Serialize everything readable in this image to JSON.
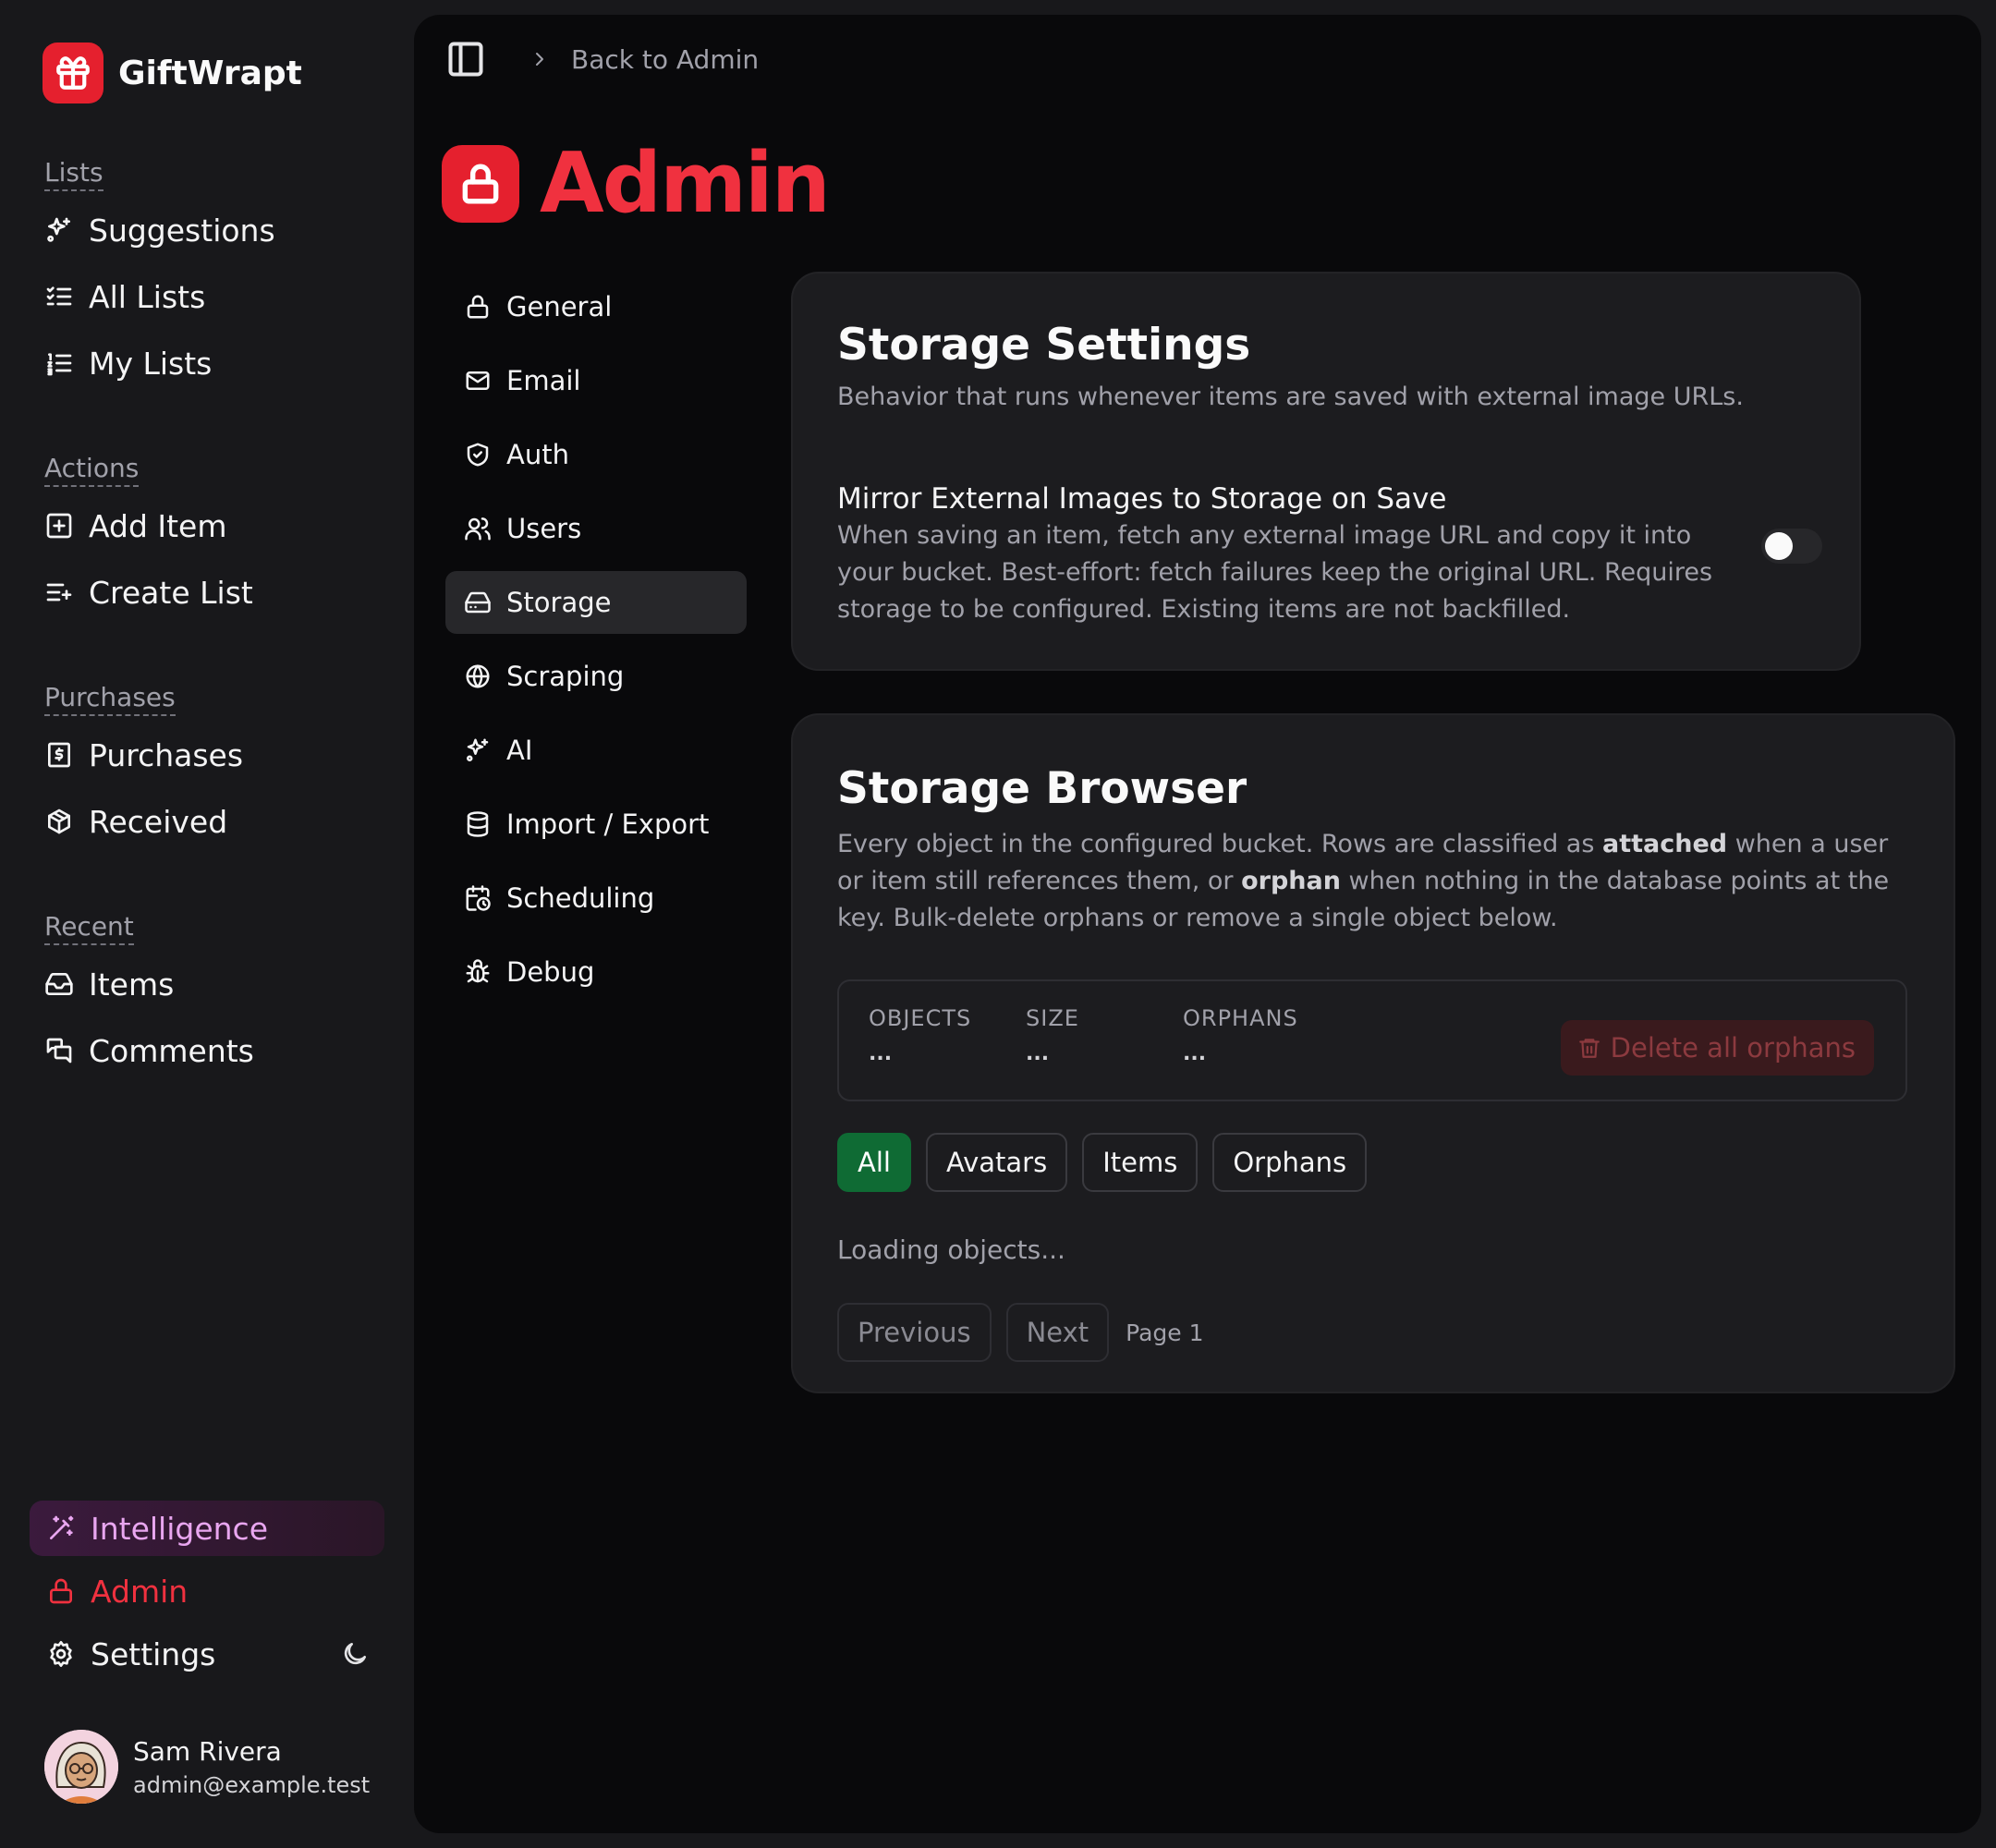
{
  "brand": {
    "name": "GiftWrapt"
  },
  "sidebar": {
    "groups": [
      {
        "label": "Lists",
        "items": [
          {
            "label": "Suggestions",
            "icon": "sparkles-icon"
          },
          {
            "label": "All Lists",
            "icon": "list-checks-icon"
          },
          {
            "label": "My Lists",
            "icon": "list-ordered-icon"
          }
        ]
      },
      {
        "label": "Actions",
        "items": [
          {
            "label": "Add Item",
            "icon": "square-plus-icon"
          },
          {
            "label": "Create List",
            "icon": "list-plus-icon"
          }
        ]
      },
      {
        "label": "Purchases",
        "items": [
          {
            "label": "Purchases",
            "icon": "receipt-icon"
          },
          {
            "label": "Received",
            "icon": "gift-box-icon"
          }
        ]
      },
      {
        "label": "Recent",
        "items": [
          {
            "label": "Items",
            "icon": "inbox-icon"
          },
          {
            "label": "Comments",
            "icon": "messages-icon"
          }
        ]
      }
    ],
    "bottom": {
      "intelligence": "Intelligence",
      "admin": "Admin",
      "settings": "Settings"
    },
    "user": {
      "name": "Sam Rivera",
      "email": "admin@example.test"
    }
  },
  "topbar": {
    "breadcrumb": "Back to Admin"
  },
  "page": {
    "title": "Admin"
  },
  "admin_nav": [
    {
      "label": "General",
      "icon": "lock-icon",
      "active": false
    },
    {
      "label": "Email",
      "icon": "mail-icon",
      "active": false
    },
    {
      "label": "Auth",
      "icon": "shield-check-icon",
      "active": false
    },
    {
      "label": "Users",
      "icon": "users-icon",
      "active": false
    },
    {
      "label": "Storage",
      "icon": "hard-drive-icon",
      "active": true
    },
    {
      "label": "Scraping",
      "icon": "globe-icon",
      "active": false
    },
    {
      "label": "AI",
      "icon": "sparkles-icon",
      "active": false
    },
    {
      "label": "Import / Export",
      "icon": "database-icon",
      "active": false
    },
    {
      "label": "Scheduling",
      "icon": "calendar-clock-icon",
      "active": false
    },
    {
      "label": "Debug",
      "icon": "bug-icon",
      "active": false
    }
  ],
  "storage_settings": {
    "title": "Storage Settings",
    "description": "Behavior that runs whenever items are saved with external image URLs.",
    "mirror_setting": {
      "title": "Mirror External Images to Storage on Save",
      "description": "When saving an item, fetch any external image URL and copy it into your bucket. Best-effort: fetch failures keep the original URL. Requires storage to be configured. Existing items are not backfilled.",
      "enabled": false
    }
  },
  "storage_browser": {
    "title": "Storage Browser",
    "description_parts": {
      "p1": "Every object in the configured bucket. Rows are classified as ",
      "attached": "attached",
      "p2": " when a user or item still references them, or ",
      "orphan": "orphan",
      "p3": " when nothing in the database points at the key. Bulk-delete orphans or remove a single object below."
    },
    "stats": [
      {
        "label": "OBJECTS",
        "value": "..."
      },
      {
        "label": "SIZE",
        "value": "..."
      },
      {
        "label": "ORPHANS",
        "value": "..."
      }
    ],
    "delete_button": "Delete all orphans",
    "filters": [
      {
        "label": "All",
        "active": true
      },
      {
        "label": "Avatars",
        "active": false
      },
      {
        "label": "Items",
        "active": false
      },
      {
        "label": "Orphans",
        "active": false
      }
    ],
    "loading_text": "Loading objects...",
    "pagination": {
      "previous": "Previous",
      "next": "Next",
      "page_label": "Page 1"
    }
  },
  "colors": {
    "brand_red": "#e5202e",
    "admin_red": "#f0313f",
    "active_filter": "#0f6b34",
    "intelligence": "#e9a6f0"
  }
}
